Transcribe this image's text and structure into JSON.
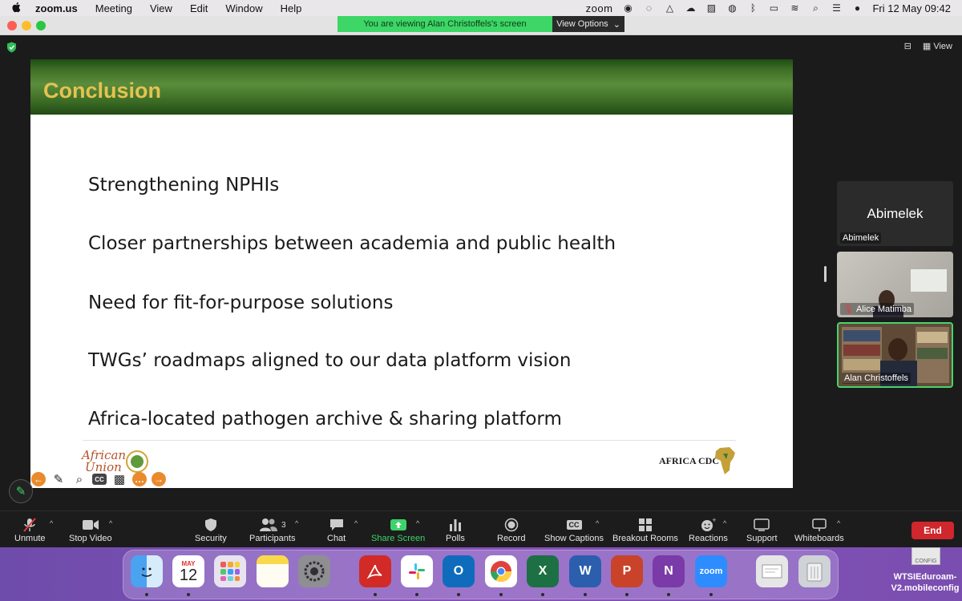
{
  "menubar": {
    "app_name": "zoom.us",
    "menus": [
      "Meeting",
      "View",
      "Edit",
      "Window",
      "Help"
    ],
    "right_app_word": "zoom",
    "clock": "Fri 12 May  09:42"
  },
  "share_banner": {
    "message": "You are viewing Alan Christoffels's screen",
    "options_label": "View Options"
  },
  "top_controls": {
    "view_label": "View"
  },
  "slide": {
    "title": "Conclusion",
    "bullets": [
      "Strengthening NPHIs",
      "Closer partnerships between academia and public health",
      "Need for fit-for-purpose solutions",
      "TWGs’ roadmaps aligned to our data platform vision",
      "Africa-located pathogen archive & sharing platform"
    ],
    "left_logo_text_1": "African",
    "left_logo_text_2": "Union",
    "right_logo_text": "AFRICA CDC"
  },
  "annotation_toolbar": {
    "cc_label": "CC"
  },
  "participants_panel": {
    "tiles": [
      {
        "big_name": "Abimelek",
        "name": "Abimelek"
      },
      {
        "name": "Alice Matimba"
      },
      {
        "name": "Alan Christoffels"
      }
    ]
  },
  "toolbar": {
    "unmute": "Unmute",
    "stop_video": "Stop Video",
    "security": "Security",
    "participants": "Participants",
    "participants_count": "3",
    "chat": "Chat",
    "share_screen": "Share Screen",
    "polls": "Polls",
    "record": "Record",
    "show_captions": "Show Captions",
    "breakout_rooms": "Breakout Rooms",
    "reactions": "Reactions",
    "support": "Support",
    "whiteboards": "Whiteboards",
    "end": "End",
    "captions_icon_text": "CC"
  },
  "dock": {
    "calendar_month": "MAY",
    "calendar_day": "12",
    "zoom_label": "zoom",
    "apps": [
      "Finder",
      "Calendar",
      "Launchpad",
      "Notes",
      "System Settings",
      "Acrobat",
      "Slack",
      "Outlook",
      "Chrome",
      "Excel",
      "Word",
      "PowerPoint",
      "OneNote",
      "Zoom",
      "Preview",
      "Trash"
    ]
  },
  "desktop_file": {
    "label": "WTSIEduroam-V2.mobileconfig",
    "icon_text": "CONFIG"
  },
  "colors": {
    "slide_title": "#e5c251",
    "header_green": "#4f8132",
    "share_green": "#3dd667",
    "end_red": "#d0262d",
    "active_tile_border": "#47d46a"
  }
}
